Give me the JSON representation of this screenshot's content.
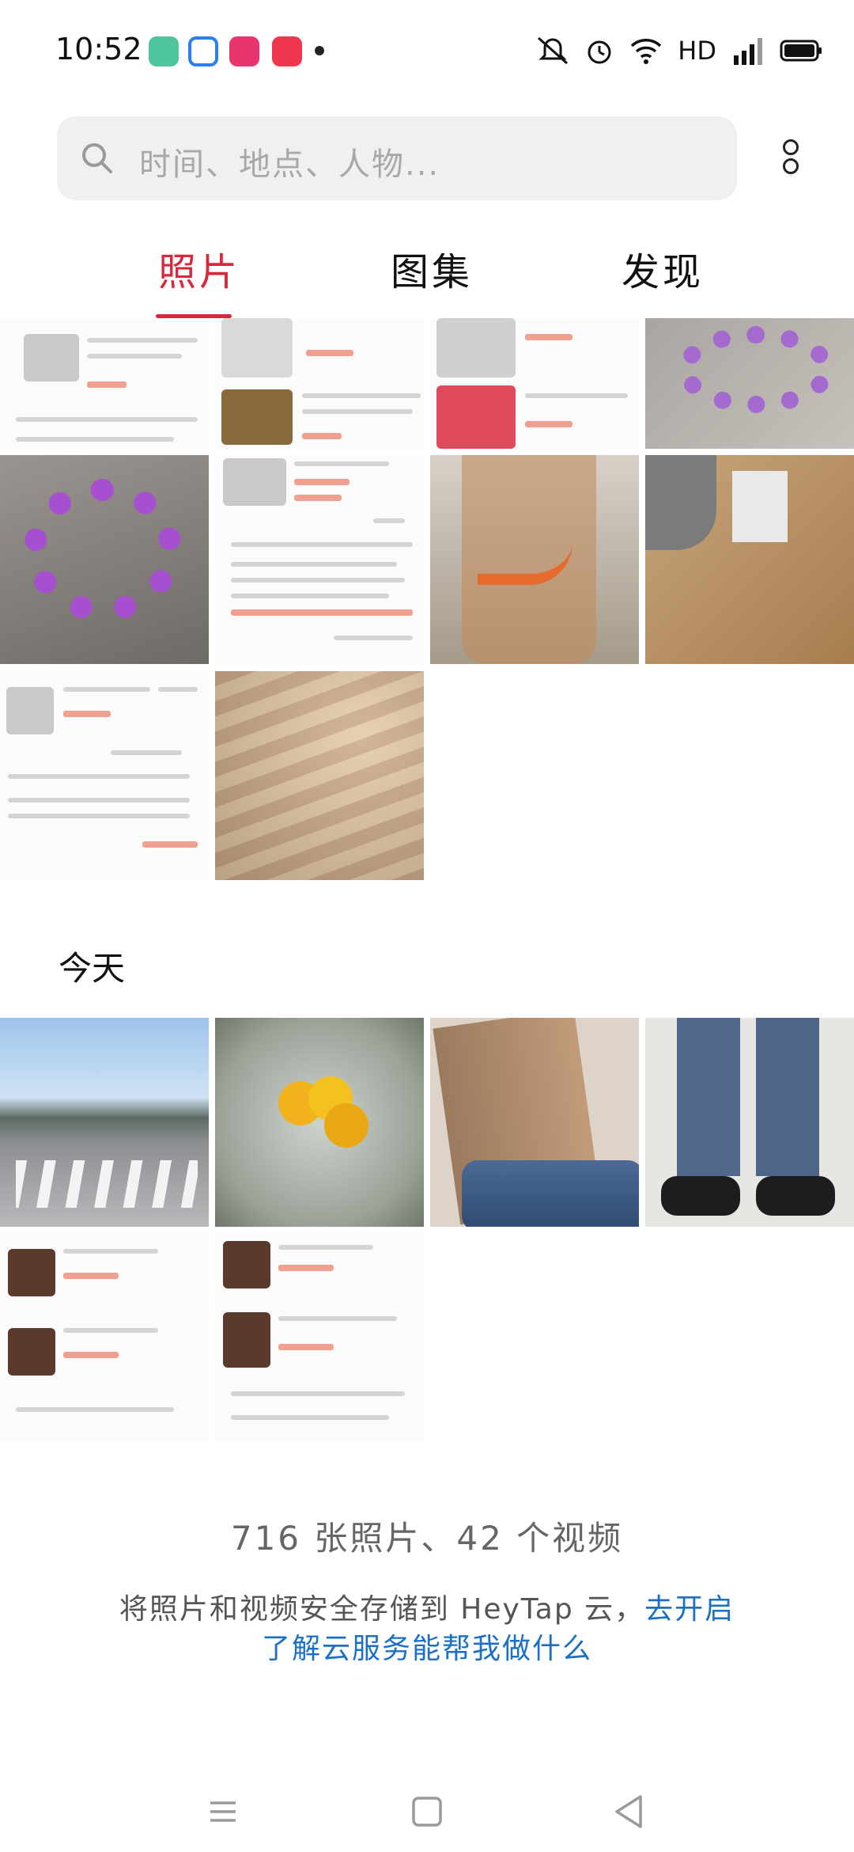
{
  "status_bar": {
    "time": "10:52",
    "network": "HD",
    "signal": "4G",
    "notification_icons": [
      "chat-app-icon",
      "cloud-app-icon",
      "video-app-icon",
      "play-app-icon"
    ]
  },
  "search": {
    "placeholder": "时间、地点、人物..."
  },
  "tabs": [
    {
      "label": "照片",
      "active": true
    },
    {
      "label": "图集",
      "active": false
    },
    {
      "label": "发现",
      "active": false
    }
  ],
  "sections": {
    "today_title": "今天"
  },
  "footer": {
    "counts": "716 张照片、42 个视频",
    "cloud_text": "将照片和视频安全存储到 HeyTap 云，",
    "cloud_link": "去开启",
    "cloud_learn_more": "了解云服务能帮我做什么"
  },
  "colors": {
    "accent": "#d8283c",
    "link": "#1a6fc9",
    "search_bg": "#f0f0f0"
  }
}
